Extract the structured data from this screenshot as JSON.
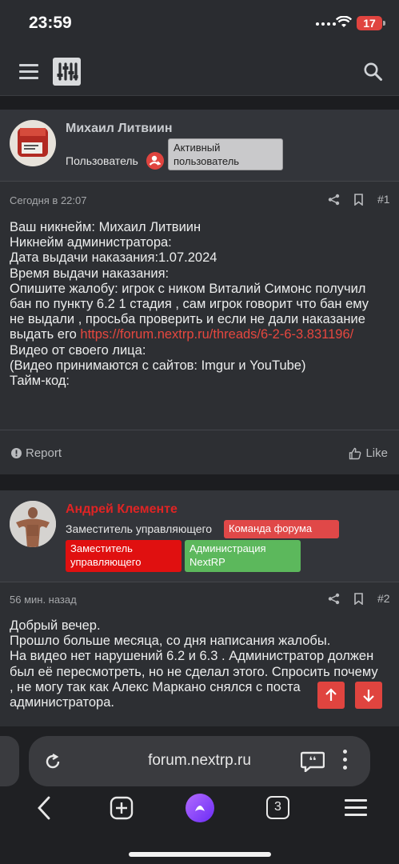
{
  "status": {
    "time": "23:59",
    "battery": "17"
  },
  "nav": {
    "menu_icon": "hamburger-icon",
    "logo_icon": "sliders-icon",
    "search_icon": "search-icon"
  },
  "posts": [
    {
      "username": "Михаил Литвиин",
      "username_color": "#c9ccd0",
      "role": "Пользователь",
      "badges": [
        {
          "text": "Активный пользователь",
          "bg": "#c9c9cb",
          "color": "#222222"
        }
      ],
      "date": "Сегодня в 22:07",
      "number": "#1",
      "lines": [
        "Ваш никнейм: Михаил Литвиин",
        "Никнейм администратора:",
        "Дата выдачи наказания:1.07.2024",
        "Время выдачи наказания:",
        "Опишите жалобу: игрок с ником Виталий Симонс получил",
        "бан по пункту 6.2 1 стадия , сам игрок говорит что бан ему",
        "не выдали , просьба проверить и если не дали наказание",
        "выдать его ",
        "Видео от своего лица:",
        "(Видео принимаются с сайтов: Imgur и YouTube)",
        "Тайм-код:"
      ],
      "link": "https://forum.nextrp.ru/threads/6-2-6-3.831196/",
      "report": "Report",
      "like": "Like"
    },
    {
      "username": "Андрей Клементе",
      "username_color": "#e02424",
      "role": "Заместитель управляющего",
      "badges": [
        {
          "text": "Команда форума",
          "bg": "#e04848",
          "color": "#ffffff"
        },
        {
          "text": "Заместитель управляющего",
          "bg": "#e01010",
          "color": "#ffffff"
        },
        {
          "text": "Администрация NextRP",
          "bg": "#5cb85c",
          "color": "#ffffff"
        }
      ],
      "date": "56 мин. назад",
      "number": "#2",
      "lines": [
        "Добрый вечер.",
        "Прошло больше месяца, со дня написания жалобы.",
        "На видео нет нарушений 6.2 и 6.3 . Администратор должен",
        "был её пересмотреть, но не сделал этого. Спросить почему",
        ", не могу так как Алекс Маркано снялся с поста",
        "администратора."
      ]
    }
  ],
  "scroll": {
    "up_icon": "arrow-up-icon",
    "down_icon": "arrow-down-icon"
  },
  "browser": {
    "url": "forum.nextrp.ru",
    "tab_count": "3"
  }
}
